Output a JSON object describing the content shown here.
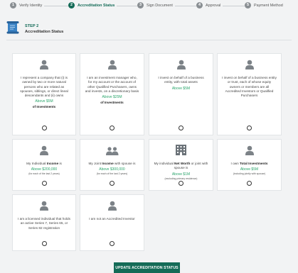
{
  "steps": [
    {
      "num": "1",
      "label": "Verify Identity"
    },
    {
      "num": "2",
      "label": "Accreditation Status"
    },
    {
      "num": "3",
      "label": "Sign Document"
    },
    {
      "num": "4",
      "label": "Approval"
    },
    {
      "num": "5",
      "label": "Payment Method"
    }
  ],
  "header": {
    "step_no": "STEP 2",
    "title": "Accreditation Status"
  },
  "cards": [
    {
      "icon": "person-icon",
      "pre": "I represent a company that (i) is owned by two or more natural persons who are related as spouses, siblings, or direct lineal descendants and (ii) owns",
      "bold": "",
      "post": "",
      "amount": "Above $5M",
      "sub": "of Investments",
      "note": ""
    },
    {
      "icon": "person-icon",
      "pre": "I am an investment manager who, for my account or the account of other Qualified Purchasers, owns and invests, on a discretionary basis",
      "bold": "",
      "post": "",
      "amount": "Above $25M",
      "sub": "of Investments",
      "note": ""
    },
    {
      "icon": "person-icon",
      "pre": "I invest on behalf of a business entity, with total assets",
      "bold": "",
      "post": "",
      "amount": "Above $5M",
      "sub": "",
      "note": ""
    },
    {
      "icon": "person-icon",
      "pre": "I invest on behalf of a business entity or trust, each of whose equity owners or members are all Accredited Investors or Qualified Purchasers",
      "bold": "",
      "post": "",
      "amount": "",
      "sub": "",
      "note": ""
    },
    {
      "icon": "person-icon",
      "pre": "My Individual ",
      "bold": "Income",
      "post": " is",
      "amount": "Above $200,000",
      "sub": "",
      "note": "(for each of the last 2 years)"
    },
    {
      "icon": "two-persons-icon",
      "pre": "My Joint ",
      "bold": "Income",
      "post": " with spouse is",
      "amount": "Above $300,000",
      "sub": "",
      "note": "(for each of the last 2 years)"
    },
    {
      "icon": "building-icon",
      "pre": "My individual ",
      "bold": "Net Worth",
      "post": " or joint with spouse is",
      "amount": "Above $1M",
      "sub": "",
      "note": "(excluding primary residence)"
    },
    {
      "icon": "person-icon",
      "pre": "I own ",
      "bold": "Total Investments",
      "post": "",
      "amount": "Above $5M",
      "sub": "",
      "note": "(including jointly with spouse)"
    },
    {
      "icon": "person-icon",
      "pre": "I am a licensed individual that holds an active Series 7, Series 65, or Series 82 registration",
      "bold": "",
      "post": "",
      "amount": "",
      "sub": "",
      "note": ""
    },
    {
      "icon": "person-icon",
      "pre": "I am not an Accredited Investor",
      "bold": "",
      "post": "",
      "amount": "",
      "sub": "",
      "note": ""
    }
  ],
  "submit_label": "UPDATE ACCREDITATION STATUS",
  "colors": {
    "accent": "#146b57",
    "amount": "#2aa56b"
  }
}
